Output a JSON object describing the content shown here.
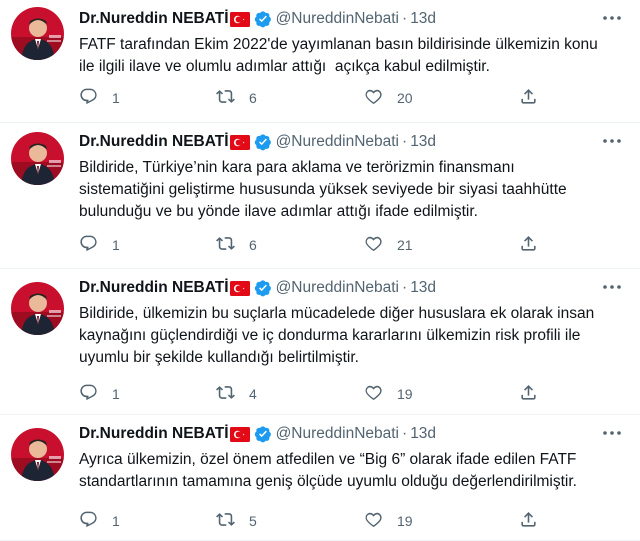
{
  "tweets": [
    {
      "name": "Dr.Nureddin NEBATİ",
      "handle": "@NureddinNebati",
      "sep": "·",
      "time": "13d",
      "text": "FATF tarafından Ekim 2022'de yayımlanan basın bildirisinde ülkemizin konu\nile ilgili ilave ve olumlu adımlar attığı  açıkça kabul edilmiştir.",
      "replies": "1",
      "retweets": "6",
      "likes": "20",
      "share": ""
    },
    {
      "name": "Dr.Nureddin NEBATİ",
      "handle": "@NureddinNebati",
      "sep": "·",
      "time": "13d",
      "text": "Bildiride, Türkiye’nin kara para aklama ve terörizmin finansmanı\nsistematiğini geliştirme hususunda yüksek seviyede bir siyasi taahhütte\nbulunduğu ve bu yönde ilave adımlar attığı ifade edilmiştir.",
      "replies": "1",
      "retweets": "6",
      "likes": "21",
      "share": ""
    },
    {
      "name": "Dr.Nureddin NEBATİ",
      "handle": "@NureddinNebati",
      "sep": "·",
      "time": "13d",
      "text": "Bildiride, ülkemizin bu suçlarla mücadelede diğer hususlara ek olarak insan\nkaynağını güçlendirdiği ve iç dondurma kararlarını ülkemizin risk profili ile\nuyumlu bir şekilde kullandığı belirtilmiştir.",
      "replies": "1",
      "retweets": "4",
      "likes": "19",
      "share": ""
    },
    {
      "name": "Dr.Nureddin NEBATİ",
      "handle": "@NureddinNebati",
      "sep": "·",
      "time": "13d",
      "text": "Ayrıca ülkemizin, özel önem atfedilen ve “Big 6” olarak ifade edilen FATF\nstandartlarının tamamına geniş ölçüde uyumlu olduğu değerlendirilmiştir.",
      "replies": "1",
      "retweets": "5",
      "likes": "19",
      "share": ""
    }
  ],
  "colors": {
    "text": "#0f1419",
    "muted": "#536471",
    "verified": "#1d9bf0",
    "flag": "#e30a17",
    "divider": "#eff3f4"
  },
  "icons": {
    "reply": "reply-icon",
    "retweet": "retweet-icon",
    "like": "heart-icon",
    "share": "share-icon",
    "more": "more-dots-icon",
    "verified": "verified-badge-icon",
    "flag": "turkey-flag-icon"
  }
}
